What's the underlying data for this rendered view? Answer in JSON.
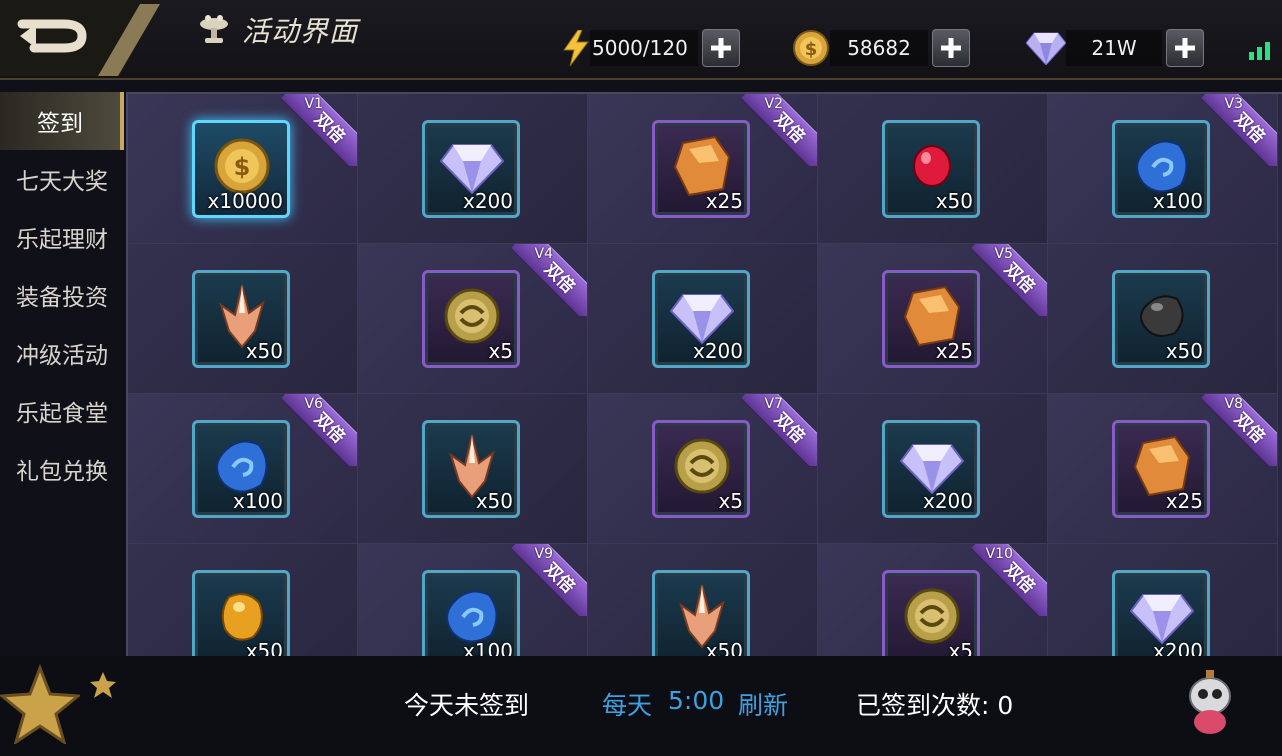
{
  "header": {
    "title": "活动界面",
    "energy": "5000/120",
    "gold": "58682",
    "diamond": "21W"
  },
  "sidebar": {
    "items": [
      {
        "label": "签到",
        "active": true
      },
      {
        "label": "七天大奖",
        "active": false
      },
      {
        "label": "乐起理财",
        "active": false
      },
      {
        "label": "装备投资",
        "active": false
      },
      {
        "label": "冲级活动",
        "active": false
      },
      {
        "label": "乐起食堂",
        "active": false
      },
      {
        "label": "礼包兑换",
        "active": false
      }
    ]
  },
  "rewards": [
    {
      "item": "gold-coin",
      "qty": "x10000",
      "vip": "V1",
      "double": "双倍",
      "frame": "selected"
    },
    {
      "item": "diamond",
      "qty": "x200",
      "vip": "",
      "double": "",
      "frame": "blue"
    },
    {
      "item": "amber-crystal",
      "qty": "x25",
      "vip": "V2",
      "double": "双倍",
      "frame": "purple"
    },
    {
      "item": "red-gem",
      "qty": "x50",
      "vip": "",
      "double": "",
      "frame": "blue"
    },
    {
      "item": "blue-stone",
      "qty": "x100",
      "vip": "V3",
      "double": "双倍",
      "frame": "blue"
    },
    {
      "item": "crystal-shard",
      "qty": "x50",
      "vip": "",
      "double": "",
      "frame": "blue"
    },
    {
      "item": "bronze-medal",
      "qty": "x5",
      "vip": "V4",
      "double": "双倍",
      "frame": "purple"
    },
    {
      "item": "diamond",
      "qty": "x200",
      "vip": "",
      "double": "",
      "frame": "blue"
    },
    {
      "item": "amber-crystal",
      "qty": "x25",
      "vip": "V5",
      "double": "双倍",
      "frame": "purple"
    },
    {
      "item": "black-stone",
      "qty": "x50",
      "vip": "",
      "double": "",
      "frame": "blue"
    },
    {
      "item": "blue-stone",
      "qty": "x100",
      "vip": "V6",
      "double": "双倍",
      "frame": "blue"
    },
    {
      "item": "crystal-shard",
      "qty": "x50",
      "vip": "",
      "double": "",
      "frame": "blue"
    },
    {
      "item": "bronze-medal",
      "qty": "x5",
      "vip": "V7",
      "double": "双倍",
      "frame": "purple"
    },
    {
      "item": "diamond",
      "qty": "x200",
      "vip": "",
      "double": "",
      "frame": "blue"
    },
    {
      "item": "amber-crystal",
      "qty": "x25",
      "vip": "V8",
      "double": "双倍",
      "frame": "purple"
    },
    {
      "item": "yellow-gem",
      "qty": "x50",
      "vip": "",
      "double": "",
      "frame": "blue"
    },
    {
      "item": "blue-stone",
      "qty": "x100",
      "vip": "V9",
      "double": "双倍",
      "frame": "blue"
    },
    {
      "item": "crystal-shard",
      "qty": "x50",
      "vip": "",
      "double": "",
      "frame": "blue"
    },
    {
      "item": "bronze-medal",
      "qty": "x5",
      "vip": "V10",
      "double": "双倍",
      "frame": "purple"
    },
    {
      "item": "diamond",
      "qty": "x200",
      "vip": "",
      "double": "",
      "frame": "blue"
    }
  ],
  "footer": {
    "status": "今天未签到",
    "refresh_label": "每天",
    "refresh_time": "5:00",
    "refresh_suffix": "刷新",
    "count_label": "已签到次数: 0"
  },
  "colors": {
    "accent_blue": "#3da0e0",
    "ribbon_purple": "#8a5ac8",
    "gold": "#d8a53a"
  }
}
